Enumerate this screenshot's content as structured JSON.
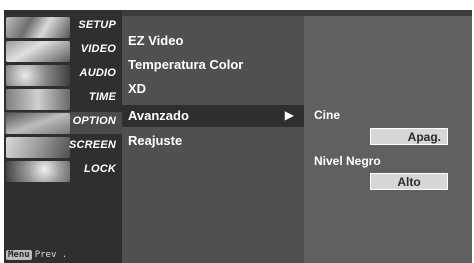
{
  "rail": {
    "items": [
      {
        "label": "SETUP"
      },
      {
        "label": "VIDEO"
      },
      {
        "label": "AUDIO"
      },
      {
        "label": "TIME"
      },
      {
        "label": "OPTION"
      },
      {
        "label": "SCREEN"
      },
      {
        "label": "LOCK"
      }
    ],
    "hint_key": "Menu",
    "hint_text": "Prev ."
  },
  "submenu": {
    "items": [
      {
        "label": "EZ Video"
      },
      {
        "label": "Temperatura Color"
      },
      {
        "label": "XD"
      },
      {
        "label": "Avanzado"
      },
      {
        "label": "Reajuste"
      }
    ],
    "selected_arrow": "▶"
  },
  "panel": {
    "cine_label": "Cine",
    "cine_value": "Apag.",
    "nivel_label": "Nivel Negro",
    "nivel_value": "Alto"
  },
  "colors": {
    "background": "#3c3c3c",
    "submenu": "#505050",
    "selected": "#2e2e2e",
    "panel": "#606060",
    "value_box": "#d7d7d7"
  }
}
